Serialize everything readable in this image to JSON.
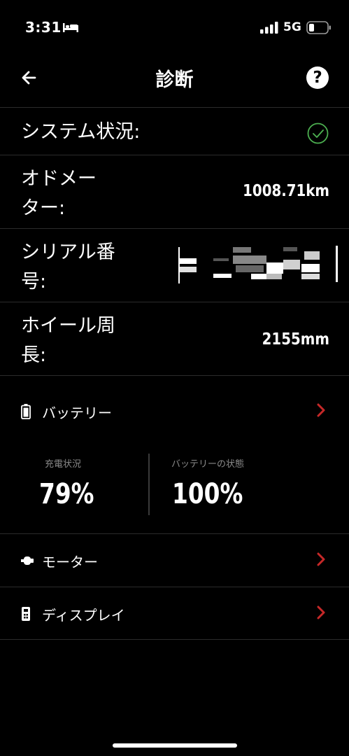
{
  "status_bar": {
    "time": "3:31",
    "network": "5G",
    "icons": [
      "bed-icon",
      "signal-icon",
      "battery-icon"
    ]
  },
  "nav": {
    "title": "診断",
    "back_icon": "arrow-left-icon",
    "help_label": "?"
  },
  "info": {
    "system_status": {
      "label": "システム状況:",
      "status_icon": "check-circle-icon",
      "status_color": "#4caf50"
    },
    "odometer": {
      "label_line1": "オドメー",
      "label_line2": "ター:",
      "value": "1008.71km"
    },
    "serial": {
      "label_line1": "シリアル番",
      "label_line2": "号:",
      "value_redacted": true
    },
    "wheel": {
      "label_line1": "ホイール周",
      "label_line2": "長:",
      "value": "2155mm"
    }
  },
  "battery": {
    "label": "バッテリー",
    "charge_label": "充電状況",
    "charge_value": "79%",
    "health_label": "バッテリーの状態",
    "health_value": "100%"
  },
  "motor": {
    "label": "モーター"
  },
  "display": {
    "label": "ディスプレイ"
  },
  "colors": {
    "background": "#000000",
    "accent_chevron": "#c62828",
    "divider": "#2b2b2b",
    "check": "#4caf50"
  }
}
